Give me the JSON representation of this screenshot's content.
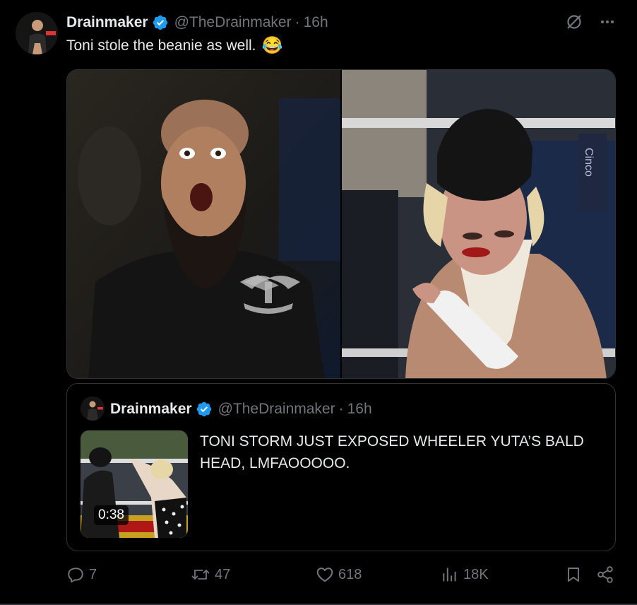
{
  "post": {
    "author_name": "Drainmaker",
    "handle": "@TheDrainmaker",
    "separator": "·",
    "time": "16h",
    "text": "Toni stole the beanie as well.",
    "emoji": "😂"
  },
  "quoted_post": {
    "author_name": "Drainmaker",
    "handle": "@TheDrainmaker",
    "separator": "·",
    "time": "16h",
    "text": "TONI STORM JUST EXPOSED WHEELER YUTA’S BALD HEAD, LMFAOOOOO.",
    "video_duration": "0:38"
  },
  "actions": {
    "replies": "7",
    "reposts": "47",
    "likes": "618",
    "views": "18K"
  },
  "icons": {
    "verified": "verified-badge-icon",
    "grok": "grok-slash-icon",
    "more": "more-dots-icon",
    "reply": "reply-icon",
    "repost": "repost-icon",
    "like": "heart-icon",
    "views": "views-chart-icon",
    "bookmark": "bookmark-icon",
    "share": "share-icon"
  },
  "colors": {
    "background": "#000000",
    "text": "#e7e9ea",
    "secondary": "#71767b",
    "border": "#2f3336",
    "verified": "#1d9bf0"
  }
}
